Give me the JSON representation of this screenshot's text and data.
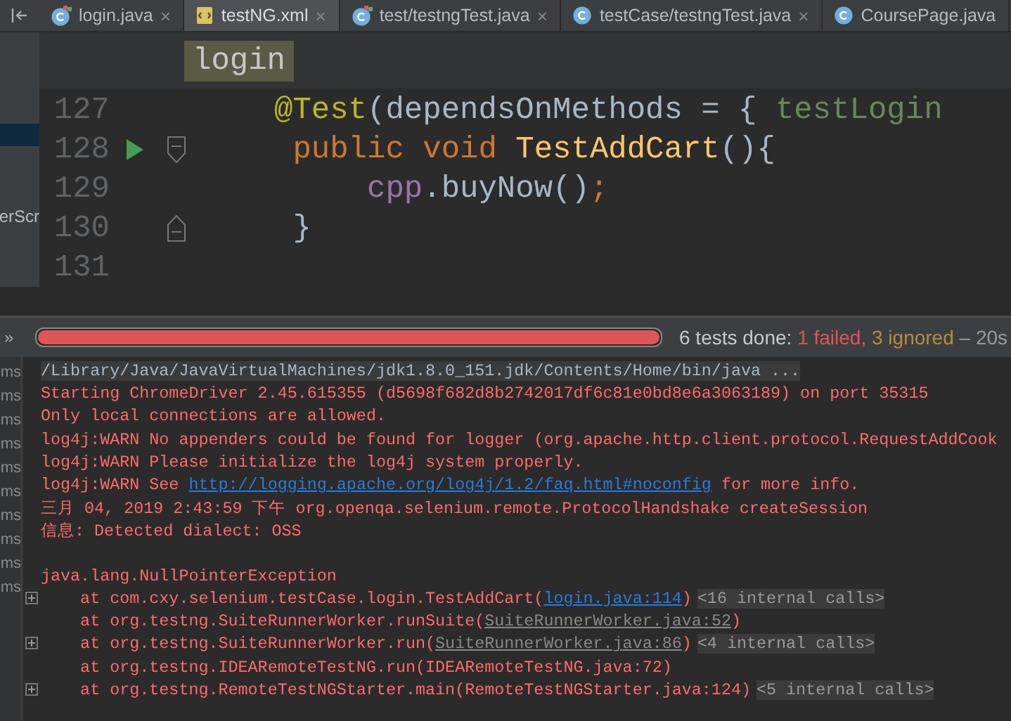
{
  "tabs": [
    {
      "label": "login.java",
      "kind": "test_class",
      "selected": false,
      "close": "×"
    },
    {
      "label": "testNG.xml",
      "kind": "xml",
      "selected": true,
      "close": "×"
    },
    {
      "label": "test/testngTest.java",
      "kind": "test_class",
      "selected": false,
      "close": "×"
    },
    {
      "label": "testCase/testngTest.java",
      "kind": "class",
      "selected": false,
      "close": "×"
    },
    {
      "label": "CoursePage.java",
      "kind": "class",
      "selected": false
    }
  ],
  "sidebar": {
    "items": [
      {
        "selected": true
      },
      {
        "label": "erScr",
        "selected": false
      }
    ]
  },
  "breadcrumb": "login",
  "editor": {
    "lines": [
      {
        "number": "127",
        "run": false,
        "fold_open": false,
        "fold_close": false,
        "tokens": [
          {
            "kind": "annotation",
            "text": "@Test"
          },
          {
            "kind": "plain",
            "text": "(dependsOnMethods = { "
          },
          {
            "kind": "string",
            "text": "testLogin"
          }
        ]
      },
      {
        "number": "128",
        "run": true,
        "fold_open": true,
        "fold_close": false,
        "tokens": [
          {
            "kind": "keyword",
            "text": " public void "
          },
          {
            "kind": "method",
            "text": "TestAddCart"
          },
          {
            "kind": "plain",
            "text": "(){"
          }
        ]
      },
      {
        "number": "129",
        "run": false,
        "fold_open": false,
        "fold_close": false,
        "tokens": [
          {
            "kind": "field",
            "text": "     cpp"
          },
          {
            "kind": "plain",
            "text": ".buyNow()"
          },
          {
            "kind": "keyword",
            "text": ";"
          }
        ]
      },
      {
        "number": "130",
        "run": false,
        "fold_open": false,
        "fold_close": true,
        "tokens": [
          {
            "kind": "plain",
            "text": " }"
          }
        ]
      },
      {
        "number": "131",
        "run": false,
        "fold_open": false,
        "fold_close": false
      }
    ]
  },
  "run_panel": {
    "toggle": "»",
    "progress": {
      "level": 1,
      "failed": true
    },
    "status": [
      {
        "kind": "plain",
        "text": "6 tests done: "
      },
      {
        "kind": "failed",
        "text": "1 failed,"
      },
      {
        "kind": "ignored",
        "text": " 3 ignored"
      },
      {
        "kind": "muted",
        "text": " – 20s"
      }
    ],
    "test_times": [
      "ms",
      "ms",
      "ms",
      "ms",
      "ms",
      "ms",
      "ms",
      "ms",
      "ms",
      "ms"
    ],
    "console": [
      {
        "expandable": false,
        "segments": [
          {
            "kind": "command",
            "text": "/Library/Java/JavaVirtualMachines/jdk1.8.0_151.jdk/Contents/Home/bin/java ..."
          }
        ]
      },
      {
        "expandable": false,
        "segments": [
          {
            "kind": "err",
            "text": "Starting ChromeDriver 2.45.615355 (d5698f682d8b2742017df6c81e0bd8e6a3063189) on port 35315"
          }
        ]
      },
      {
        "expandable": false,
        "segments": [
          {
            "kind": "err",
            "text": "Only local connections are allowed."
          }
        ]
      },
      {
        "expandable": false,
        "segments": [
          {
            "kind": "err",
            "text": "log4j:WARN No appenders could be found for logger (org.apache.http.client.protocol.RequestAddCook"
          }
        ]
      },
      {
        "expandable": false,
        "segments": [
          {
            "kind": "err",
            "text": "log4j:WARN Please initialize the log4j system properly."
          }
        ]
      },
      {
        "expandable": false,
        "segments": [
          {
            "kind": "err",
            "text": "log4j:WARN See "
          },
          {
            "kind": "link",
            "text": "http://logging.apache.org/log4j/1.2/faq.html#noconfig"
          },
          {
            "kind": "err",
            "text": " for more info."
          }
        ]
      },
      {
        "expandable": false,
        "segments": [
          {
            "kind": "err",
            "text": "三月 04, 2019 2:43:59 下午 org.openqa.selenium.remote.ProtocolHandshake createSession"
          }
        ]
      },
      {
        "expandable": false,
        "segments": [
          {
            "kind": "err",
            "text": "信息: Detected dialect: OSS"
          }
        ]
      },
      {
        "expandable": false
      },
      {
        "expandable": false,
        "segments": [
          {
            "kind": "err",
            "text": "java.lang.NullPointerException"
          }
        ]
      },
      {
        "expandable": true,
        "segments": [
          {
            "kind": "err",
            "text": "    at com.cxy.selenium.testCase.login.TestAddCart("
          },
          {
            "kind": "link",
            "text": "login.java:114"
          },
          {
            "kind": "err",
            "text": ")"
          },
          {
            "kind": "fold",
            "text": "<16 internal calls>"
          }
        ]
      },
      {
        "expandable": false,
        "segments": [
          {
            "kind": "err",
            "text": "    at org.testng.SuiteRunnerWorker.runSuite("
          },
          {
            "kind": "lib_link",
            "text": "SuiteRunnerWorker.java:52"
          },
          {
            "kind": "err",
            "text": ")"
          }
        ]
      },
      {
        "expandable": true,
        "segments": [
          {
            "kind": "err",
            "text": "    at org.testng.SuiteRunnerWorker.run("
          },
          {
            "kind": "lib_link",
            "text": "SuiteRunnerWorker.java:86"
          },
          {
            "kind": "err",
            "text": ")"
          },
          {
            "kind": "fold",
            "text": "<4 internal calls>"
          }
        ]
      },
      {
        "expandable": false,
        "segments": [
          {
            "kind": "err",
            "text": "    at org.testng.IDEARemoteTestNG.run(IDEARemoteTestNG.java:72)"
          }
        ]
      },
      {
        "expandable": true,
        "segments": [
          {
            "kind": "err",
            "text": "    at org.testng.RemoteTestNGStarter.main(RemoteTestNGStarter.java:124)"
          },
          {
            "kind": "fold",
            "text": "<5 internal calls>"
          }
        ]
      }
    ]
  }
}
